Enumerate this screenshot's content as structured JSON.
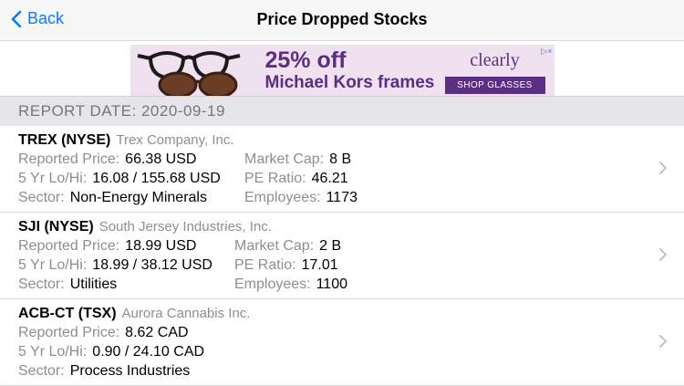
{
  "nav": {
    "back_label": "Back",
    "title": "Price Dropped Stocks"
  },
  "ad": {
    "headline": "25% off",
    "subline": "Michael Kors frames",
    "brand": "clearly",
    "cta": "SHOP GLASSES",
    "adchoices": "▷×"
  },
  "report": {
    "label": "REPORT DATE: 2020-09-19"
  },
  "stocks": [
    {
      "ticker": "TREX (NYSE)",
      "company": "Trex Company, Inc.",
      "reported_price_label": "Reported Price:",
      "reported_price": "66.38 USD",
      "lohi_label": "5 Yr Lo/Hi:",
      "lohi": "16.08 / 155.68 USD",
      "sector_label": "Sector:",
      "sector": "Non-Energy Minerals",
      "marketcap_label": "Market Cap:",
      "marketcap": "8 B",
      "pe_label": "PE Ratio:",
      "pe": "46.21",
      "employees_label": "Employees:",
      "employees": "1173"
    },
    {
      "ticker": "SJI (NYSE)",
      "company": "South Jersey Industries, Inc.",
      "reported_price_label": "Reported Price:",
      "reported_price": "18.99 USD",
      "lohi_label": "5 Yr Lo/Hi:",
      "lohi": "18.99 / 38.12 USD",
      "sector_label": "Sector:",
      "sector": "Utilities",
      "marketcap_label": "Market Cap:",
      "marketcap": "2 B",
      "pe_label": "PE Ratio:",
      "pe": "17.01",
      "employees_label": "Employees:",
      "employees": "1100"
    },
    {
      "ticker": "ACB-CT (TSX)",
      "company": "Aurora Cannabis Inc.",
      "reported_price_label": "Reported Price:",
      "reported_price": "8.62 CAD",
      "lohi_label": "5 Yr Lo/Hi:",
      "lohi": "0.90 / 24.10 CAD",
      "sector_label": "Sector:",
      "sector": "Process Industries"
    }
  ],
  "colors": {
    "accent": "#0a7aff",
    "ad_purple": "#5a2f82",
    "secondary_text": "#8e8e93"
  }
}
